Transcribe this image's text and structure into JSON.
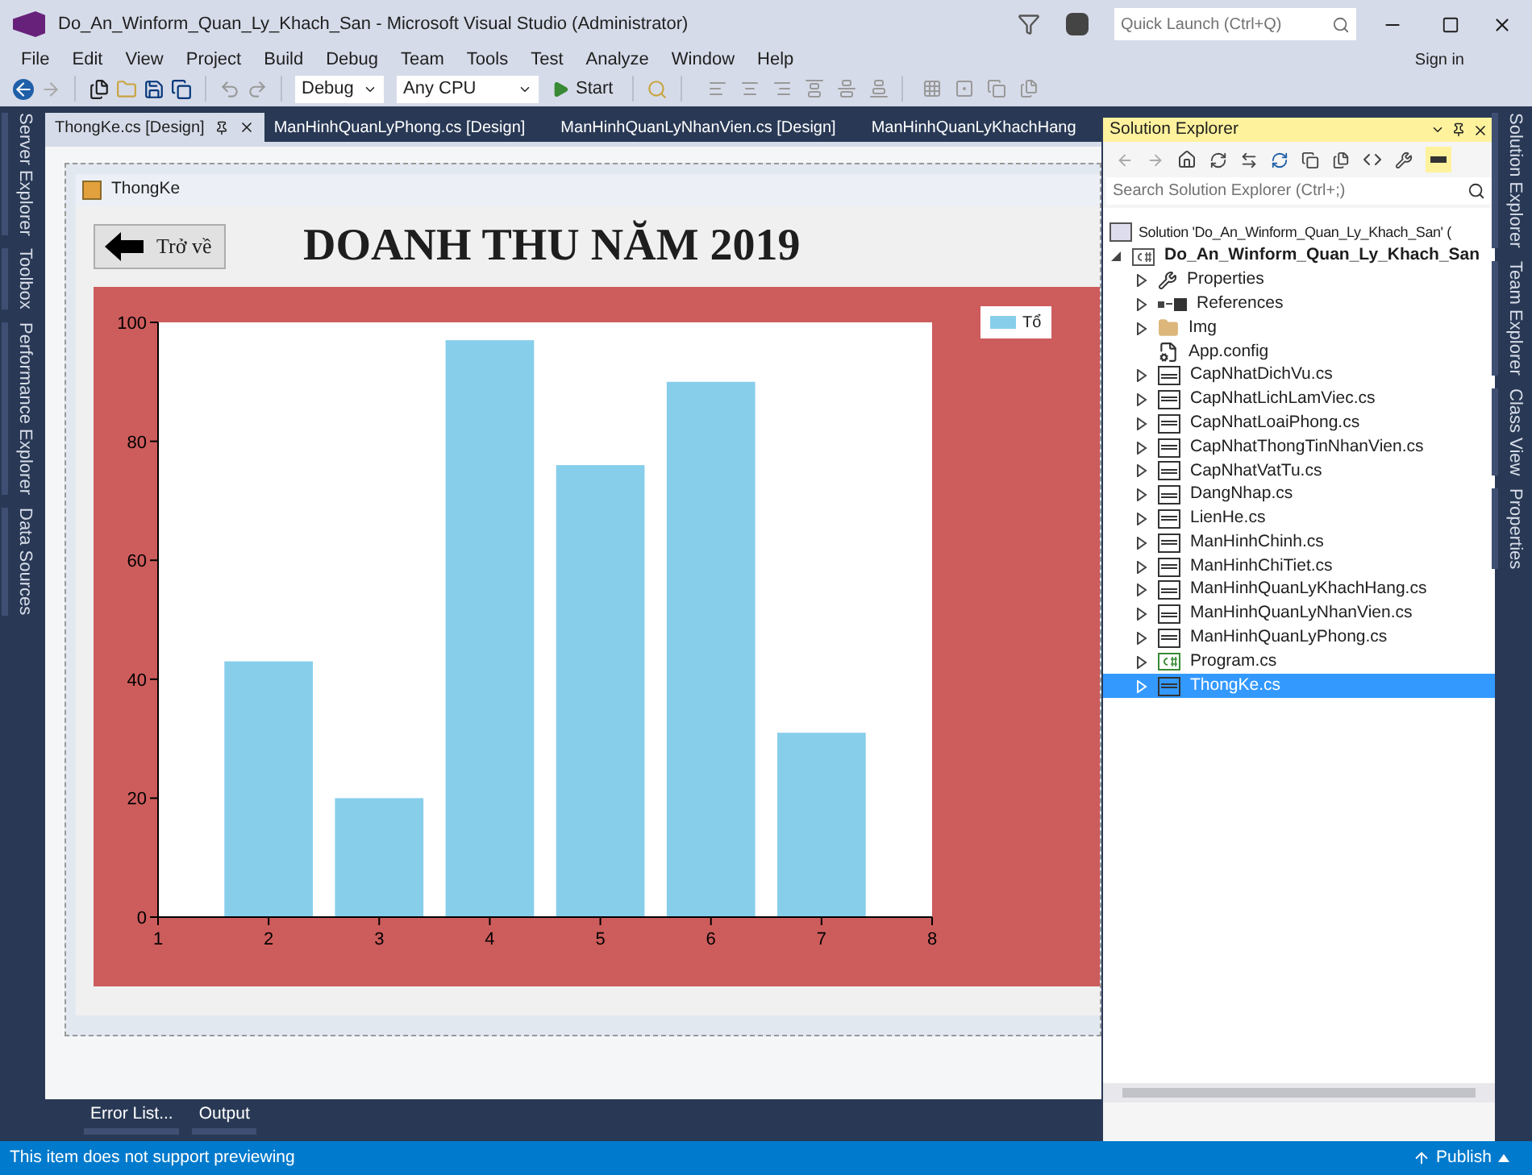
{
  "window": {
    "title": "Do_An_Winform_Quan_Ly_Khach_San - Microsoft Visual Studio (Administrator)",
    "quick_launch": {
      "placeholder": "Quick Launch (Ctrl+Q)"
    },
    "sign_in": "Sign in"
  },
  "menu": [
    "File",
    "Edit",
    "View",
    "Project",
    "Build",
    "Debug",
    "Team",
    "Tools",
    "Test",
    "Analyze",
    "Window",
    "Help"
  ],
  "toolbar": {
    "configuration": "Debug",
    "platform": "Any CPU",
    "start": "Start"
  },
  "left_strip": [
    "Server Explorer",
    "Toolbox",
    "Performance Explorer",
    "Data Sources"
  ],
  "right_strip": [
    "Solution Explorer",
    "Team Explorer",
    "Class View",
    "Properties"
  ],
  "tabs": [
    {
      "label": "ThongKe.cs [Design]",
      "selected": true
    },
    {
      "label": "ManHinhQuanLyPhong.cs [Design]",
      "selected": false
    },
    {
      "label": "ManHinhQuanLyNhanVien.cs [Design]",
      "selected": false
    },
    {
      "label": "ManHinhQuanLyKhachHang",
      "selected": false
    }
  ],
  "form": {
    "title": "ThongKe",
    "back_button": "Trở về",
    "heading": "DOANH THU NĂM 2019",
    "chart_data": {
      "type": "bar",
      "x": [
        2,
        3,
        4,
        5,
        6,
        7
      ],
      "series": [
        {
          "name": "Tổ",
          "color": "#87ceeb",
          "values": [
            43,
            20,
            97,
            76,
            90,
            31
          ]
        }
      ],
      "xlim": [
        1,
        8
      ],
      "ylim": [
        0,
        100
      ],
      "xticks": [
        1,
        2,
        3,
        4,
        5,
        6,
        7,
        8
      ],
      "yticks": [
        0,
        20,
        40,
        60,
        80,
        100
      ]
    }
  },
  "solution_explorer": {
    "title": "Solution Explorer",
    "search": {
      "placeholder": "Search Solution Explorer (Ctrl+;)"
    },
    "tree": [
      {
        "kind": "solution",
        "label": "Solution 'Do_An_Winform_Quan_Ly_Khach_San' (",
        "selected": false,
        "children": [
          {
            "kind": "project",
            "label": "Do_An_Winform_Quan_Ly_Khach_San",
            "expanded": true,
            "selected": false,
            "children": [
              {
                "kind": "properties",
                "label": "Properties",
                "expanded": false,
                "selected": false
              },
              {
                "kind": "references",
                "label": "References",
                "expanded": false,
                "selected": false
              },
              {
                "kind": "folder",
                "label": "Img",
                "expanded": false,
                "selected": false
              },
              {
                "kind": "config",
                "label": "App.config",
                "selected": false
              },
              {
                "kind": "form",
                "label": "CapNhatDichVu.cs",
                "expanded": false,
                "selected": false
              },
              {
                "kind": "form",
                "label": "CapNhatLichLamViec.cs",
                "expanded": false,
                "selected": false
              },
              {
                "kind": "form",
                "label": "CapNhatLoaiPhong.cs",
                "expanded": false,
                "selected": false
              },
              {
                "kind": "form",
                "label": "CapNhatThongTinNhanVien.cs",
                "expanded": false,
                "selected": false
              },
              {
                "kind": "form",
                "label": "CapNhatVatTu.cs",
                "expanded": false,
                "selected": false
              },
              {
                "kind": "form",
                "label": "DangNhap.cs",
                "expanded": false,
                "selected": false
              },
              {
                "kind": "form",
                "label": "LienHe.cs",
                "expanded": false,
                "selected": false
              },
              {
                "kind": "form",
                "label": "ManHinhChinh.cs",
                "expanded": false,
                "selected": false
              },
              {
                "kind": "form",
                "label": "ManHinhChiTiet.cs",
                "expanded": false,
                "selected": false
              },
              {
                "kind": "form",
                "label": "ManHinhQuanLyKhachHang.cs",
                "expanded": false,
                "selected": false
              },
              {
                "kind": "form",
                "label": "ManHinhQuanLyNhanVien.cs",
                "expanded": false,
                "selected": false
              },
              {
                "kind": "form",
                "label": "ManHinhQuanLyPhong.cs",
                "expanded": false,
                "selected": false
              },
              {
                "kind": "program",
                "label": "Program.cs",
                "expanded": false,
                "selected": false
              },
              {
                "kind": "form",
                "label": "ThongKe.cs",
                "expanded": false,
                "selected": true
              }
            ]
          }
        ]
      }
    ]
  },
  "bottom_tabs": [
    "Error List...",
    "Output"
  ],
  "status_bar": {
    "message": "This item does not support previewing",
    "publish": "Publish"
  }
}
